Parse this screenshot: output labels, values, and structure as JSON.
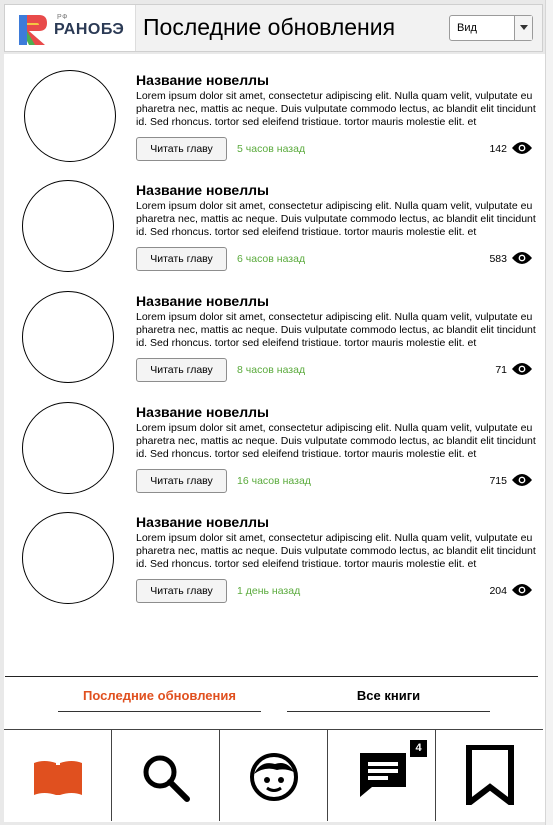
{
  "header": {
    "logo_rf": "РФ",
    "logo_name": "РАНОБЭ",
    "title": "Последние обновления",
    "view_select": "Вид"
  },
  "feed": [
    {
      "title": "Название новеллы",
      "description": "Lorem ipsum dolor sit amet, consectetur adipiscing elit. Nulla quam velit, vulputate eu pharetra nec, mattis ac neque. Duis vulputate commodo lectus, ac blandit elit tincidunt id. Sed rhoncus, tortor sed eleifend tristique, tortor mauris molestie elit, et",
      "button": "Читать главу",
      "time": "5 часов назад",
      "views": "142"
    },
    {
      "title": "Название новеллы",
      "description": "Lorem ipsum dolor sit amet, consectetur adipiscing elit. Nulla quam velit, vulputate eu pharetra nec, mattis ac neque. Duis vulputate commodo lectus, ac blandit elit tincidunt id. Sed rhoncus, tortor sed eleifend tristique, tortor mauris molestie elit, et",
      "button": "Читать главу",
      "time": "6 часов назад",
      "views": "583"
    },
    {
      "title": "Название новеллы",
      "description": "Lorem ipsum dolor sit amet, consectetur adipiscing elit. Nulla quam velit, vulputate eu pharetra nec, mattis ac neque. Duis vulputate commodo lectus, ac blandit elit tincidunt id. Sed rhoncus, tortor sed eleifend tristique, tortor mauris molestie elit, et",
      "button": "Читать главу",
      "time": "8 часов назад",
      "views": "71"
    },
    {
      "title": "Название новеллы",
      "description": "Lorem ipsum dolor sit amet, consectetur adipiscing elit. Nulla quam velit, vulputate eu pharetra nec, mattis ac neque. Duis vulputate commodo lectus, ac blandit elit tincidunt id. Sed rhoncus, tortor sed eleifend tristique, tortor mauris molestie elit, et",
      "button": "Читать главу",
      "time": "16 часов назад",
      "views": "715"
    },
    {
      "title": "Название новеллы",
      "description": "Lorem ipsum dolor sit amet, consectetur adipiscing elit. Nulla quam velit, vulputate eu pharetra nec, mattis ac neque. Duis vulputate commodo lectus, ac blandit elit tincidunt id. Sed rhoncus, tortor sed eleifend tristique, tortor mauris molestie elit, et",
      "button": "Читать главу",
      "time": "1 день назад",
      "views": "204"
    }
  ],
  "tabs": {
    "latest": "Последние обновления",
    "all_books": "Все книги"
  },
  "bottom_nav": {
    "items": [
      "book-icon",
      "search-icon",
      "profile-icon",
      "chat-icon",
      "bookmark-icon"
    ],
    "chat_badge": "4"
  },
  "colors": {
    "accent": "#e0501f",
    "time_green": "#5aaa3c",
    "logo_red": "#e84a4a",
    "logo_blue": "#3d7bd9",
    "logo_yellow": "#f4c542",
    "logo_text": "#2b3a55"
  }
}
